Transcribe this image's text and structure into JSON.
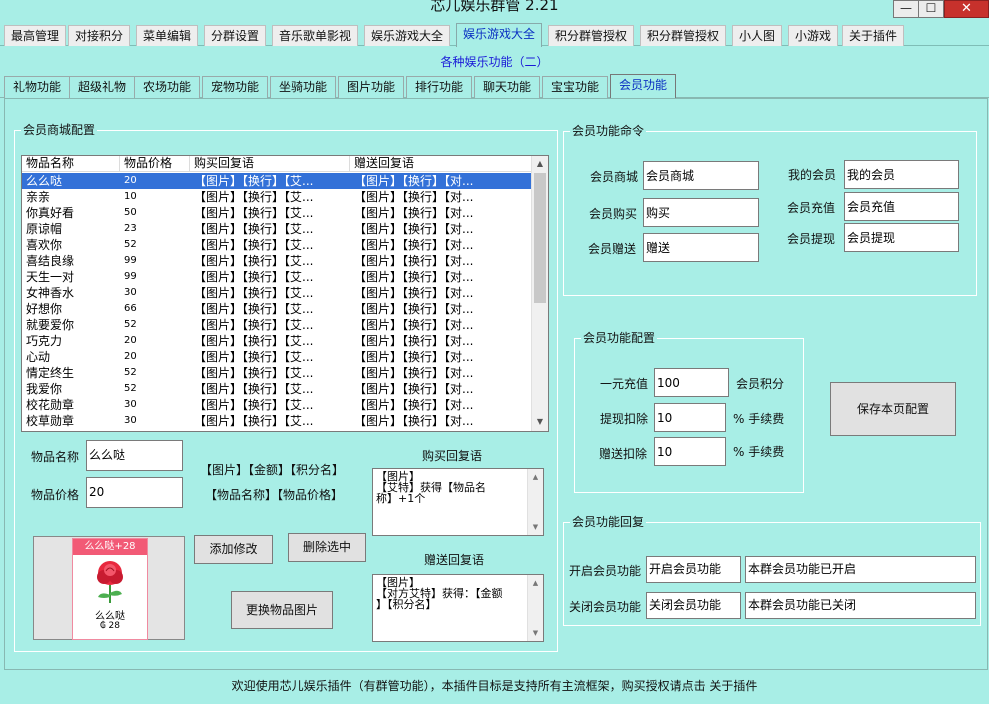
{
  "window": {
    "title": "芯儿娱乐群管 2.21",
    "minimize": "—",
    "maximize": "☐",
    "close": "✕"
  },
  "main_tabs": [
    "最高管理",
    "对接积分",
    "菜单编辑",
    "分群设置",
    "音乐歌单影视",
    "娱乐游戏大全",
    "娱乐游戏大全",
    "积分群管授权",
    "积分群管授权",
    "小人图",
    "小游戏",
    "关于插件"
  ],
  "sub_heading": "各种娱乐功能（二）",
  "sub_tabs": [
    "礼物功能",
    "超级礼物",
    "农场功能",
    "宠物功能",
    "坐骑功能",
    "图片功能",
    "排行功能",
    "聊天功能",
    "宝宝功能",
    "会员功能"
  ],
  "shop": {
    "legend": "会员商城配置",
    "columns": [
      "物品名称",
      "物品价格",
      "购买回复语",
      "赠送回复语"
    ],
    "buy_reply": "【图片】【换行】【艾...",
    "gift_reply": "【图片】【换行】【对...",
    "items": [
      {
        "name": "么么哒",
        "price": "20"
      },
      {
        "name": "亲亲",
        "price": "10"
      },
      {
        "name": "你真好看",
        "price": "50"
      },
      {
        "name": "原谅帽",
        "price": "23"
      },
      {
        "name": "喜欢你",
        "price": "52"
      },
      {
        "name": "喜结良缘",
        "price": "99"
      },
      {
        "name": "天生一对",
        "price": "99"
      },
      {
        "name": "女神香水",
        "price": "30"
      },
      {
        "name": "好想你",
        "price": "66"
      },
      {
        "name": "就要爱你",
        "price": "52"
      },
      {
        "name": "巧克力",
        "price": "20"
      },
      {
        "name": "心动",
        "price": "20"
      },
      {
        "name": "情定终生",
        "price": "52"
      },
      {
        "name": "我爱你",
        "price": "52"
      },
      {
        "name": "校花勋章",
        "price": "30"
      },
      {
        "name": "校草勋章",
        "price": "30"
      }
    ],
    "name_label": "物品名称",
    "name_value": "么么哒",
    "price_label": "物品价格",
    "price_value": "20",
    "tag_line1": "【图片】【金额】【积分名】",
    "tag_line2": "【物品名称】【物品价格】",
    "buy_reply_label": "购买回复语",
    "buy_reply_lines": [
      "【图片】",
      "【艾特】获得【物品名",
      "称】+1个"
    ],
    "gift_reply_label": "赠送回复语",
    "gift_reply_lines": [
      "【图片】",
      "【对方艾特】获得：【金额",
      "】【积分名】"
    ],
    "add_button": "添加修改",
    "delete_button": "删除选中",
    "change_image_button": "更换物品图片",
    "preview": {
      "header": "么么哒+28",
      "name": "么么哒",
      "price": "₲ 28"
    }
  },
  "commands": {
    "legend": "会员功能命令",
    "rows": [
      {
        "label": "会员商城",
        "value": "会员商城"
      },
      {
        "label": "会员购买",
        "value": "购买"
      },
      {
        "label": "会员赠送",
        "value": "赠送"
      },
      {
        "label": "我的会员",
        "value": "我的会员"
      },
      {
        "label": "会员充值",
        "value": "会员充值"
      },
      {
        "label": "会员提现",
        "value": "会员提现"
      }
    ]
  },
  "config": {
    "legend": "会员功能配置",
    "recharge_label": "一元充值",
    "recharge_value": "100",
    "recharge_unit": "会员积分",
    "withdraw_label": "提现扣除",
    "withdraw_value": "10",
    "withdraw_unit": "% 手续费",
    "gift_label": "赠送扣除",
    "gift_value": "10",
    "gift_unit": "% 手续费",
    "save_button": "保存本页配置"
  },
  "reply": {
    "legend": "会员功能回复",
    "open_label": "开启会员功能",
    "open_cmd": "开启会员功能",
    "open_reply": "本群会员功能已开启",
    "close_label": "关闭会员功能",
    "close_cmd": "关闭会员功能",
    "close_reply": "本群会员功能已关闭"
  },
  "status_text": "欢迎使用芯儿娱乐插件（有群管功能），本插件目标是支持所有主流框架，购买授权请点击 关于插件",
  "colors": {
    "background": "#a8eee6",
    "selection": "#3371d8",
    "accent_text": "#0a2fc2",
    "close_button": "#c7312c"
  }
}
